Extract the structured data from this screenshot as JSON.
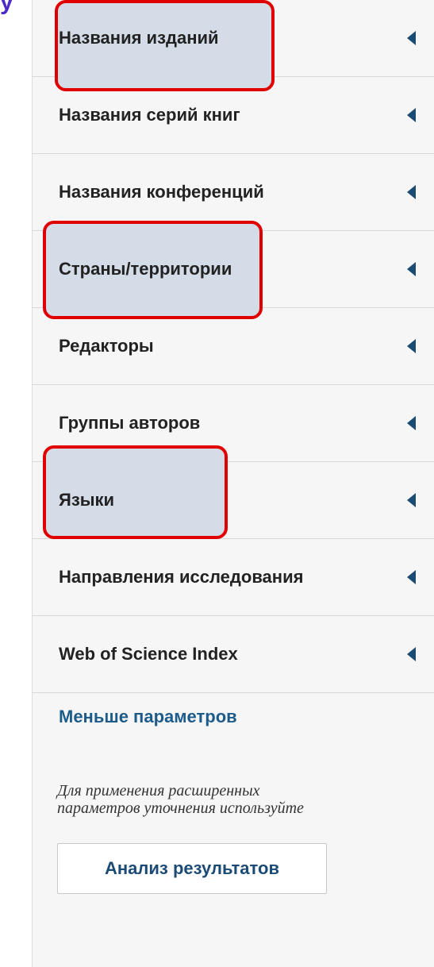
{
  "corner_glyph": "y",
  "filters": [
    {
      "label": "Названия изданий",
      "icon": "caret-left-icon",
      "highlighted": true
    },
    {
      "label": "Названия серий книг",
      "icon": "caret-left-icon",
      "highlighted": false
    },
    {
      "label": "Названия конференций",
      "icon": "caret-left-icon",
      "highlighted": false
    },
    {
      "label": "Страны/территории",
      "icon": "caret-left-icon",
      "highlighted": true
    },
    {
      "label": "Редакторы",
      "icon": "caret-left-icon",
      "highlighted": false
    },
    {
      "label": "Группы авторов",
      "icon": "caret-left-icon",
      "highlighted": false
    },
    {
      "label": "Языки",
      "icon": "caret-left-icon",
      "highlighted": true
    },
    {
      "label": "Направления исследования",
      "icon": "caret-left-icon",
      "highlighted": false
    },
    {
      "label": "Web of Science Index",
      "icon": "caret-left-icon",
      "highlighted": false
    }
  ],
  "less_options_link": "Меньше параметров",
  "hint_text": "Для применения расширенных параметров уточнения используйте",
  "analyze_button": "Анализ результатов",
  "colors": {
    "highlight_border": "#e00000",
    "highlight_fill": "#d4dce7",
    "link": "#1d5b8a",
    "caret": "#1a4b73",
    "panel_background": "#f6f6f6"
  }
}
